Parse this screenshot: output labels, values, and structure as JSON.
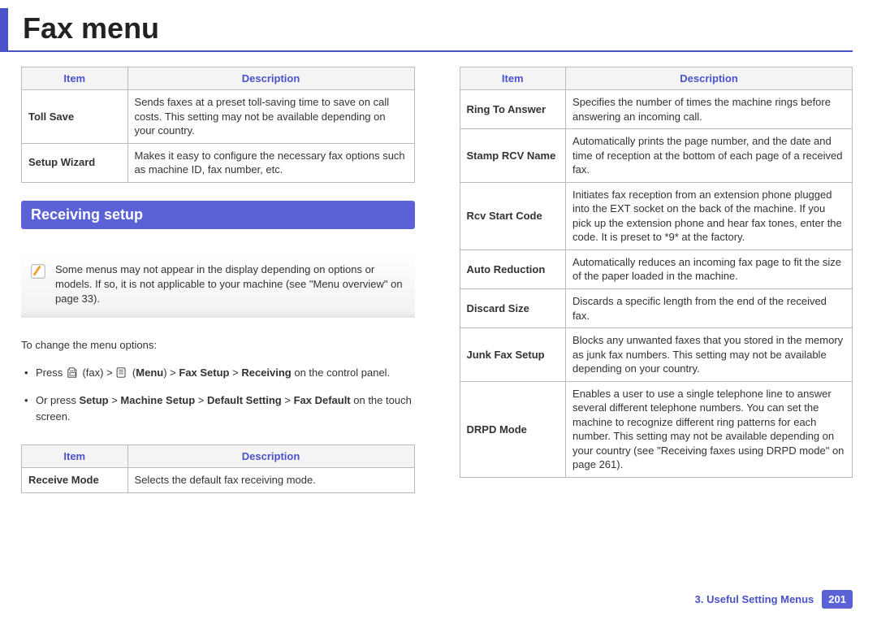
{
  "page_title": "Fax menu",
  "table_headers": {
    "item": "Item",
    "desc": "Description"
  },
  "top_table": [
    {
      "item": "Toll Save",
      "desc": "Sends faxes at a preset toll-saving time to save on call costs. This setting may not be available depending on your country."
    },
    {
      "item": "Setup Wizard",
      "desc": "Makes it easy to configure the necessary fax options such as machine ID, fax number, etc."
    }
  ],
  "section_heading": "Receiving setup",
  "note_text": "Some menus may not appear in the display depending on options or models. If so, it is not applicable to your machine (see \"Menu overview\" on page 33).",
  "instruction_intro": "To change the menu options:",
  "step1": {
    "prefix": "Press ",
    "fax_label": " (fax) > ",
    "menu_prefix": " (",
    "menu_bold": "Menu",
    "rest": ") > ",
    "b1": "Fax Setup",
    "sep": " > ",
    "b2": "Receiving",
    "tail": " on the control panel."
  },
  "step2": {
    "prefix": "Or press ",
    "b1": "Setup",
    "sep": " > ",
    "b2": "Machine Setup",
    "b3": "Default Setting",
    "b4": "Fax Default",
    "tail": " on the touch screen."
  },
  "left_table2": [
    {
      "item": "Receive Mode",
      "desc": "Selects the default fax receiving mode."
    }
  ],
  "right_table": [
    {
      "item": "Ring To Answer",
      "desc": "Specifies the number of times the machine rings before answering an incoming call."
    },
    {
      "item": "Stamp RCV Name",
      "desc": "Automatically prints the page number, and the date and time of reception at the bottom of each page of a received fax."
    },
    {
      "item": "Rcv Start Code",
      "desc": "Initiates fax reception from an extension phone plugged into the EXT socket on the back of the machine. If you pick up the extension phone and hear fax tones, enter the code. It is preset to *9* at the factory."
    },
    {
      "item": "Auto Reduction",
      "desc": "Automatically reduces an incoming fax page to fit the size of the paper loaded in the machine."
    },
    {
      "item": "Discard Size",
      "desc": "Discards a specific length from the end of the received fax."
    },
    {
      "item": "Junk Fax Setup",
      "desc": "Blocks any unwanted faxes that you stored in the memory as junk fax numbers. This setting may not be available depending on your country."
    },
    {
      "item": "DRPD Mode",
      "desc": " Enables a user to use a single telephone line to answer several different telephone numbers. You can set the machine to recognize different ring patterns for each number. This setting may not be available depending on your country (see \"Receiving faxes using DRPD mode\" on page 261)."
    }
  ],
  "footer": {
    "chapter": "3.  Useful Setting Menus",
    "page": "201"
  }
}
